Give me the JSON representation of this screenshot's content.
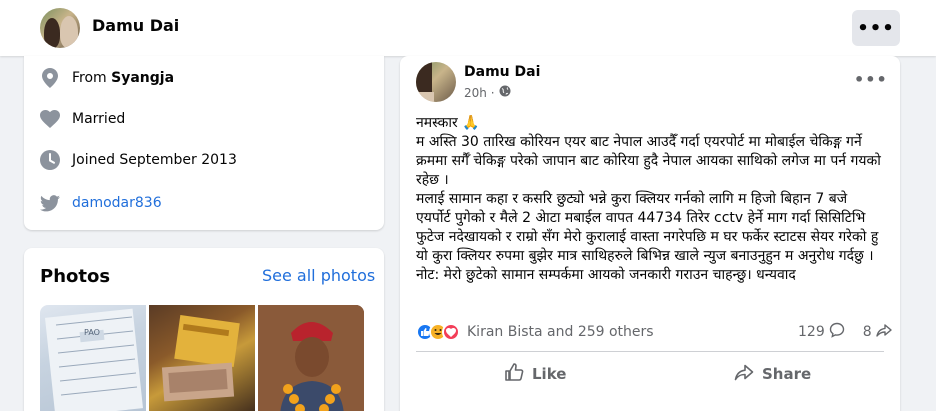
{
  "profile": {
    "name": "Damu Dai",
    "more_label": "•••"
  },
  "intro": {
    "from_prefix": "From ",
    "from_place": "Syangja",
    "relationship": "Married",
    "joined": "Joined September 2013",
    "twitter_handle": "damodar836"
  },
  "photos": {
    "title": "Photos",
    "see_all": "See all photos",
    "thumb1_text": "PAO"
  },
  "post": {
    "author": "Damu Dai",
    "time": "20h ·",
    "more_label": "•••",
    "paragraphs": [
      "नमस्कार 🙏",
      "म अस्ति 30 तारिख कोरियन एयर बाट नेपाल आउदैँ गर्दा एयरपोर्ट मा मोबाईल चेकिङ्ग गर्ने क्रममा सर्गैँ चेकिङ्ग परेको जापान बाट कोरिया हुदै नेपाल आयका साथिको लगेज मा पर्न गयको रहेछ ।",
      "मलाई सामान कहा र कसरि छुट्यो भन्ने कुरा क्लियर गर्नको  लागि म हिजो बिहान 7 बजे एयर्पोर्ट पुगेको र मैले 2  अेाटा मबाईल वापत 44734 तिरेर cctv हेर्ने माग गर्दा सिसिटिभि फुटेज नदेखायको र राम्रो सँग मेरो कुरालाई वास्ता नगरेपछि म घर फर्केर स्टाटस सेयर गरेको हु यो कुरा क्लियर रुपमा बुझेर मात्र साथिहरुले बिभिन्न खाले न्युज बनाउनुहुन म अनुरोध गर्दछु ।",
      "नोट: मेरो छुटेको सामान सम्पर्कमा आयको जनकारी गराउन चाहन्छु। धन्यवाद"
    ],
    "reactions_text": "Kiran Bista and 259 others",
    "comments_count": "129",
    "shares_count": "8",
    "like_label": "Like",
    "share_label": "Share"
  },
  "colors": {
    "link": "#216fdb",
    "like_blue": "#1877f2",
    "muted": "#65676b",
    "background": "#f0f2f5"
  },
  "icons": [
    "location-pin-icon",
    "heart-icon",
    "clock-icon",
    "twitter-icon",
    "globe-icon",
    "like-reaction-icon",
    "haha-reaction-icon",
    "love-reaction-icon",
    "comment-icon",
    "share-icon",
    "thumbs-up-icon",
    "more-icon"
  ]
}
